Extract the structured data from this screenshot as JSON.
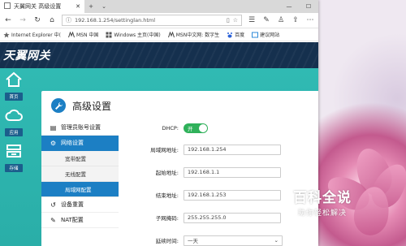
{
  "browser": {
    "tab_title": "天翼网关 高级设置",
    "tab_close": "✕",
    "new_tab": "+",
    "tab_list": "⌄",
    "minimize": "—",
    "maximize": "☐",
    "url": "192.168.1.254/settinglan.html",
    "favorites": [
      {
        "label": "Internet Explorer 中(",
        "icon": "star-icon"
      },
      {
        "label": "MSN 中国",
        "icon": "msn-icon"
      },
      {
        "label": "Windows 主页(中国)",
        "icon": "windows-icon"
      },
      {
        "label": "MSN中文网: 数字生",
        "icon": "msn-icon"
      },
      {
        "label": "百度",
        "icon": "baidu-icon"
      },
      {
        "label": "建议网站",
        "icon": "suggested-icon"
      }
    ]
  },
  "page": {
    "brand": "天翼网关",
    "rail": [
      {
        "label": "首页",
        "icon": "home-icon"
      },
      {
        "label": "应用",
        "icon": "cloud-icon"
      },
      {
        "label": "存储",
        "icon": "storage-icon"
      }
    ],
    "panel_title": "高级设置",
    "menu": [
      {
        "label": "管理员账号设置",
        "icon": "id-card-icon",
        "active": false
      },
      {
        "label": "网络设置",
        "icon": "gear-icon",
        "active": true
      }
    ],
    "submenu": [
      {
        "label": "宽带配置",
        "active": false
      },
      {
        "label": "无线配置",
        "active": false
      },
      {
        "label": "局域网配置",
        "active": true
      }
    ],
    "menu_after": [
      {
        "label": "设备重置",
        "icon": "reset-icon"
      },
      {
        "label": "NAT配置",
        "icon": "wrench-icon"
      }
    ],
    "form": {
      "dhcp_label": "DHCP:",
      "dhcp_toggle": "开",
      "lan_ip_label": "局域网地址:",
      "lan_ip_value": "192.168.1.254",
      "start_label": "起始地址:",
      "start_value": "192.168.1.1",
      "end_label": "结束地址:",
      "end_value": "192.168.1.253",
      "mask_label": "子网掩码:",
      "mask_value": "255.255.255.0",
      "lease_label": "延续时间:",
      "lease_value": "一天"
    }
  },
  "watermark": {
    "line1": "百科全说",
    "line2": "助你轻松解决"
  }
}
